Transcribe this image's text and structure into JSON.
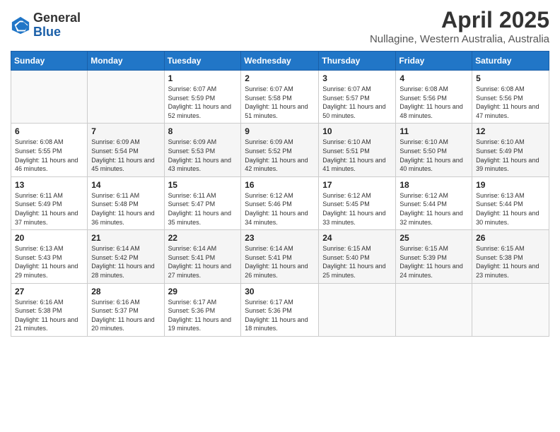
{
  "header": {
    "logo_general": "General",
    "logo_blue": "Blue",
    "month_year": "April 2025",
    "location": "Nullagine, Western Australia, Australia"
  },
  "calendar": {
    "days_of_week": [
      "Sunday",
      "Monday",
      "Tuesday",
      "Wednesday",
      "Thursday",
      "Friday",
      "Saturday"
    ],
    "weeks": [
      [
        {
          "day": "",
          "info": ""
        },
        {
          "day": "",
          "info": ""
        },
        {
          "day": "1",
          "info": "Sunrise: 6:07 AM\nSunset: 5:59 PM\nDaylight: 11 hours and 52 minutes."
        },
        {
          "day": "2",
          "info": "Sunrise: 6:07 AM\nSunset: 5:58 PM\nDaylight: 11 hours and 51 minutes."
        },
        {
          "day": "3",
          "info": "Sunrise: 6:07 AM\nSunset: 5:57 PM\nDaylight: 11 hours and 50 minutes."
        },
        {
          "day": "4",
          "info": "Sunrise: 6:08 AM\nSunset: 5:56 PM\nDaylight: 11 hours and 48 minutes."
        },
        {
          "day": "5",
          "info": "Sunrise: 6:08 AM\nSunset: 5:56 PM\nDaylight: 11 hours and 47 minutes."
        }
      ],
      [
        {
          "day": "6",
          "info": "Sunrise: 6:08 AM\nSunset: 5:55 PM\nDaylight: 11 hours and 46 minutes."
        },
        {
          "day": "7",
          "info": "Sunrise: 6:09 AM\nSunset: 5:54 PM\nDaylight: 11 hours and 45 minutes."
        },
        {
          "day": "8",
          "info": "Sunrise: 6:09 AM\nSunset: 5:53 PM\nDaylight: 11 hours and 43 minutes."
        },
        {
          "day": "9",
          "info": "Sunrise: 6:09 AM\nSunset: 5:52 PM\nDaylight: 11 hours and 42 minutes."
        },
        {
          "day": "10",
          "info": "Sunrise: 6:10 AM\nSunset: 5:51 PM\nDaylight: 11 hours and 41 minutes."
        },
        {
          "day": "11",
          "info": "Sunrise: 6:10 AM\nSunset: 5:50 PM\nDaylight: 11 hours and 40 minutes."
        },
        {
          "day": "12",
          "info": "Sunrise: 6:10 AM\nSunset: 5:49 PM\nDaylight: 11 hours and 39 minutes."
        }
      ],
      [
        {
          "day": "13",
          "info": "Sunrise: 6:11 AM\nSunset: 5:49 PM\nDaylight: 11 hours and 37 minutes."
        },
        {
          "day": "14",
          "info": "Sunrise: 6:11 AM\nSunset: 5:48 PM\nDaylight: 11 hours and 36 minutes."
        },
        {
          "day": "15",
          "info": "Sunrise: 6:11 AM\nSunset: 5:47 PM\nDaylight: 11 hours and 35 minutes."
        },
        {
          "day": "16",
          "info": "Sunrise: 6:12 AM\nSunset: 5:46 PM\nDaylight: 11 hours and 34 minutes."
        },
        {
          "day": "17",
          "info": "Sunrise: 6:12 AM\nSunset: 5:45 PM\nDaylight: 11 hours and 33 minutes."
        },
        {
          "day": "18",
          "info": "Sunrise: 6:12 AM\nSunset: 5:44 PM\nDaylight: 11 hours and 32 minutes."
        },
        {
          "day": "19",
          "info": "Sunrise: 6:13 AM\nSunset: 5:44 PM\nDaylight: 11 hours and 30 minutes."
        }
      ],
      [
        {
          "day": "20",
          "info": "Sunrise: 6:13 AM\nSunset: 5:43 PM\nDaylight: 11 hours and 29 minutes."
        },
        {
          "day": "21",
          "info": "Sunrise: 6:14 AM\nSunset: 5:42 PM\nDaylight: 11 hours and 28 minutes."
        },
        {
          "day": "22",
          "info": "Sunrise: 6:14 AM\nSunset: 5:41 PM\nDaylight: 11 hours and 27 minutes."
        },
        {
          "day": "23",
          "info": "Sunrise: 6:14 AM\nSunset: 5:41 PM\nDaylight: 11 hours and 26 minutes."
        },
        {
          "day": "24",
          "info": "Sunrise: 6:15 AM\nSunset: 5:40 PM\nDaylight: 11 hours and 25 minutes."
        },
        {
          "day": "25",
          "info": "Sunrise: 6:15 AM\nSunset: 5:39 PM\nDaylight: 11 hours and 24 minutes."
        },
        {
          "day": "26",
          "info": "Sunrise: 6:15 AM\nSunset: 5:38 PM\nDaylight: 11 hours and 23 minutes."
        }
      ],
      [
        {
          "day": "27",
          "info": "Sunrise: 6:16 AM\nSunset: 5:38 PM\nDaylight: 11 hours and 21 minutes."
        },
        {
          "day": "28",
          "info": "Sunrise: 6:16 AM\nSunset: 5:37 PM\nDaylight: 11 hours and 20 minutes."
        },
        {
          "day": "29",
          "info": "Sunrise: 6:17 AM\nSunset: 5:36 PM\nDaylight: 11 hours and 19 minutes."
        },
        {
          "day": "30",
          "info": "Sunrise: 6:17 AM\nSunset: 5:36 PM\nDaylight: 11 hours and 18 minutes."
        },
        {
          "day": "",
          "info": ""
        },
        {
          "day": "",
          "info": ""
        },
        {
          "day": "",
          "info": ""
        }
      ]
    ]
  }
}
